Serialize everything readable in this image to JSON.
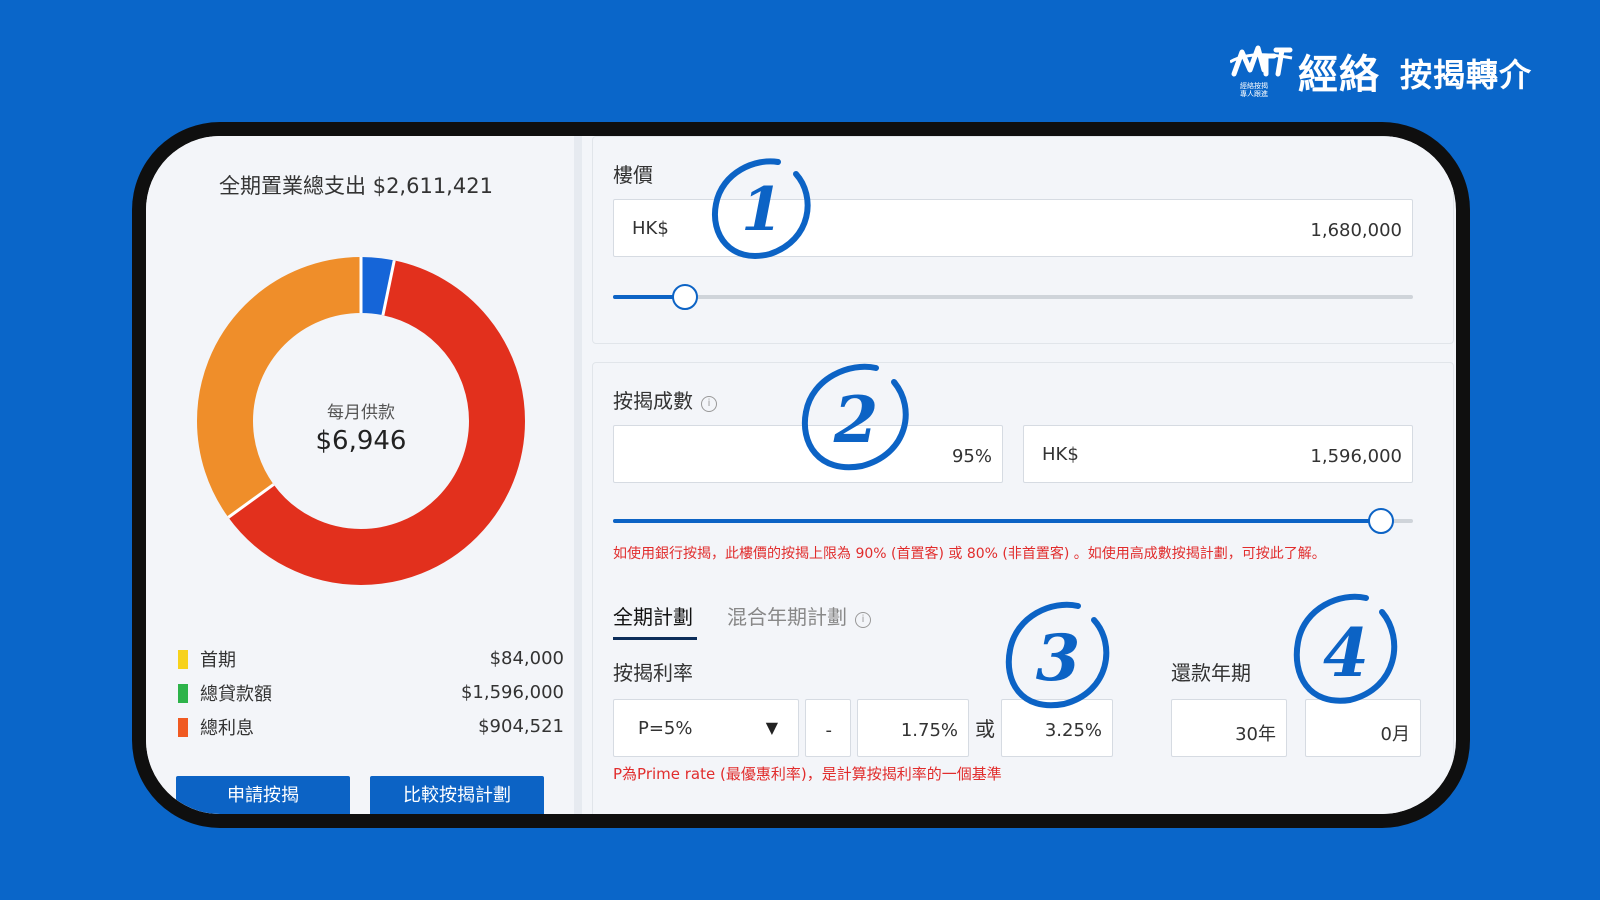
{
  "brand": {
    "name": "經絡",
    "tagline": "按揭轉介",
    "sub_line1": "經絡按揭",
    "sub_line2": "專人跟進"
  },
  "summary": {
    "total_label": "全期置業總支出 $2,611,421",
    "monthly_label": "每月供款",
    "monthly_value": "$6,946"
  },
  "chart_data": {
    "type": "pie",
    "slices": [
      {
        "label": "首期",
        "value": 84000,
        "color": "#1565d8"
      },
      {
        "label": "總貸款額",
        "value": 1596000,
        "color": "#e2301d"
      },
      {
        "label": "總利息",
        "value": 904521,
        "color": "#ef8e2a"
      }
    ]
  },
  "legend": [
    {
      "label": "首期",
      "value": "$84,000",
      "color": "#f7d21c"
    },
    {
      "label": "總貸款額",
      "value": "$1,596,000",
      "color": "#2db34a"
    },
    {
      "label": "總利息",
      "value": "$904,521",
      "color": "#f05a22"
    }
  ],
  "buttons": {
    "apply": "申請按揭",
    "compare": "比較按揭計劃"
  },
  "property": {
    "label": "樓價",
    "currency": "HK$",
    "value": "1,680,000",
    "slider_fraction": 0.09
  },
  "mortgage": {
    "label": "按揭成數",
    "info": "i",
    "percent": "95%",
    "currency": "HK$",
    "amount": "1,596,000",
    "slider_fraction": 0.96,
    "warning": "如使用銀行按揭，此樓價的按揭上限為 90% (首置客) 或 80% (非首置客) 。如使用高成數按揭計劃，可按此了解。"
  },
  "tabs": [
    {
      "label": "全期計劃",
      "active": true
    },
    {
      "label": "混合年期計劃",
      "active": false
    }
  ],
  "rate": {
    "label": "按揭利率",
    "select_value": "P=5%",
    "minus": "-",
    "spread": "1.75%",
    "or": "或",
    "capped": "3.25%",
    "note": "P為Prime rate (最優惠利率)，是計算按揭利率的一個基準"
  },
  "term": {
    "label": "還款年期",
    "years": "30年",
    "months": "0月"
  },
  "annotations": [
    "1",
    "2",
    "3",
    "4"
  ],
  "colors": {
    "background": "#0a66c9",
    "accent": "#0c63c5",
    "warning": "#e12d2d"
  }
}
